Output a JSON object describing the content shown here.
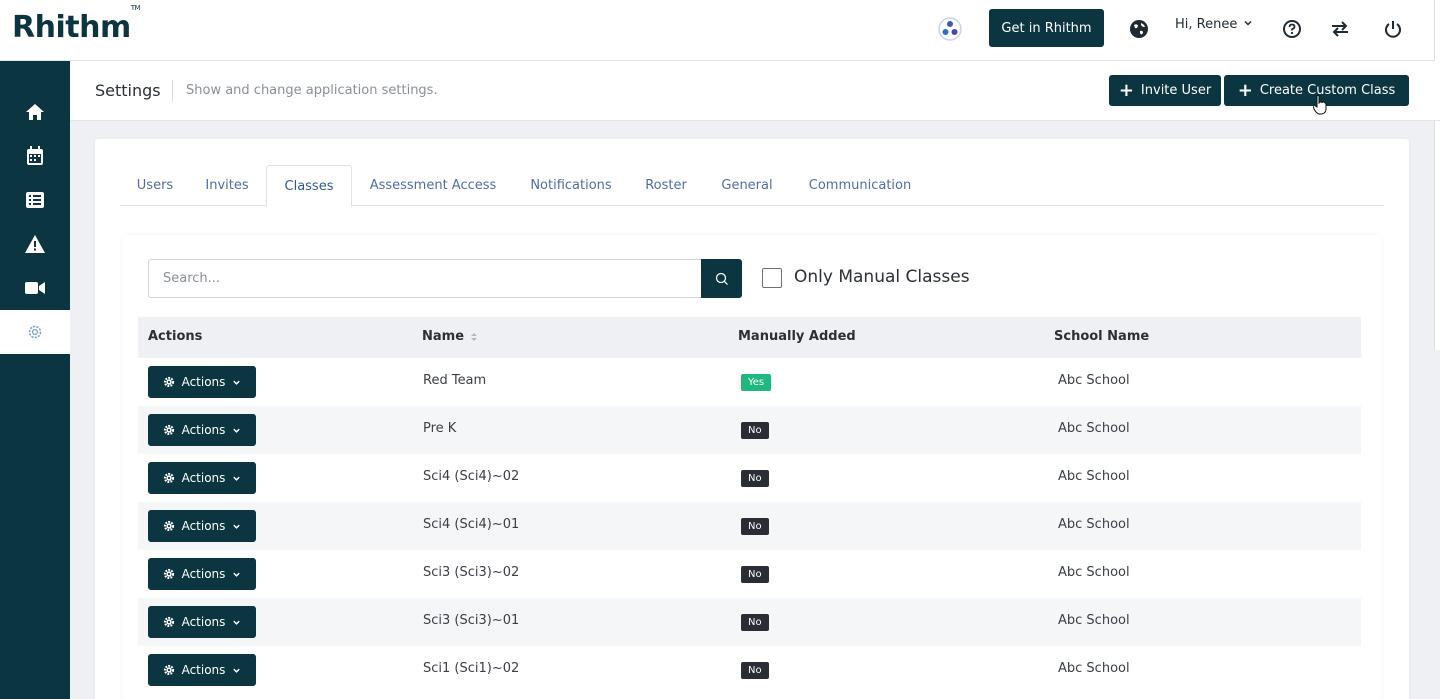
{
  "app": {
    "logo": "Rhithm",
    "get_button": "Get in Rhithm",
    "user_greeting": "Hi, Renee"
  },
  "header": {
    "title": "Settings",
    "description": "Show and change application settings.",
    "invite_label": "Invite User",
    "create_label": "Create Custom Class"
  },
  "tabs": [
    "Users",
    "Invites",
    "Classes",
    "Assessment Access",
    "Notifications",
    "Roster",
    "General",
    "Communication"
  ],
  "active_tab": "Classes",
  "filters": {
    "search_placeholder": "Search...",
    "manual_label": "Only Manual Classes"
  },
  "table": {
    "headers": [
      "Actions",
      "Name",
      "Manually Added",
      "School Name"
    ],
    "action_label": "Actions",
    "rows": [
      {
        "name": "Red Team",
        "manual": "Yes",
        "school": "Abc School"
      },
      {
        "name": "Pre K",
        "manual": "No",
        "school": "Abc School"
      },
      {
        "name": "Sci4 (Sci4)~02",
        "manual": "No",
        "school": "Abc School"
      },
      {
        "name": "Sci4 (Sci4)~01",
        "manual": "No",
        "school": "Abc School"
      },
      {
        "name": "Sci3 (Sci3)~02",
        "manual": "No",
        "school": "Abc School"
      },
      {
        "name": "Sci3 (Sci3)~01",
        "manual": "No",
        "school": "Abc School"
      },
      {
        "name": "Sci1 (Sci1)~02",
        "manual": "No",
        "school": "Abc School"
      }
    ]
  },
  "colors": {
    "primary": "#0b3540",
    "yes_badge": "#1fb87f",
    "no_badge": "#2a2d34",
    "tab_link": "#4f6fa3"
  }
}
